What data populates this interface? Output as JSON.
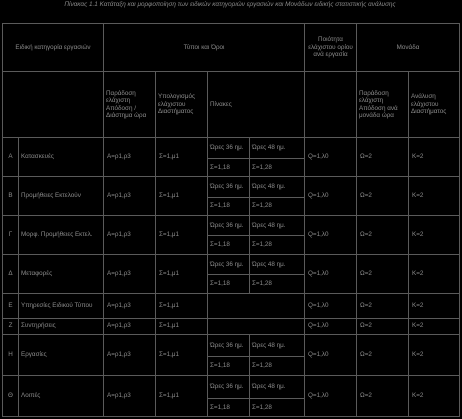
{
  "caption": "Πίνακας 1.1 Κατάταξη και μορφοποίηση των ειδικών κατηγοριών εργασιών και Μονάδων ειδικής στατιστικής ανάλυσης",
  "headers": {
    "cat": "Ειδική κατηγορία εργασιών",
    "pay_group": "Τύποι και Όροι",
    "pay_a": "Παράδοση ελάχιστη Απόδοση / Διάστημα ώρα",
    "pay_b": "Υπολογισμός ελάχιστου Διαστήματος",
    "pay_c": "Πίνακες",
    "qual": "Ποιότητα ελάχιστου ορίου ανά εργασία",
    "unit_group": "Μονάδα",
    "unit_a": "Παράδοση ελάχιστη Απόδοση ανά μονάδα ώρα",
    "unit_b": "Ανάλυση ελάχιστου Διαστήματος"
  },
  "rows": [
    {
      "id": "A",
      "name": "Κατασκευές",
      "pa": "Α=ρ1,ρ3",
      "pb": "Σ=1,μ1",
      "c1": [
        "Ώρες 36 ημ.",
        "Σ=1,18"
      ],
      "c2": [
        "Ώρες 48 ημ.",
        "Σ=1,28"
      ],
      "q": "Q=1,λ0",
      "ua": "Ω=2",
      "ub": "Κ=2"
    },
    {
      "id": "Β",
      "name": "Προμήθειες Εκτελούν",
      "pa": "Α=ρ1,ρ3",
      "pb": "Σ=1,μ1",
      "c1": [
        "Ώρες 36 ημ.",
        "Σ=1,18"
      ],
      "c2": [
        "Ώρες 48 ημ.",
        "Σ=1,28"
      ],
      "q": "Q=1,λ0",
      "ua": "Ω=2",
      "ub": "Κ=2"
    },
    {
      "id": "Γ",
      "name": "Μορφ. Προμήθειες Εκτελ.",
      "pa": "Α=ρ1,ρ3",
      "pb": "Σ=1,μ1",
      "c1": [
        "Ώρες 36 ημ.",
        "Σ=1,18"
      ],
      "c2": [
        "Ώρες 48 ημ.",
        "Σ=1,28"
      ],
      "q": "Q=1,λ0",
      "ua": "Ω=2",
      "ub": "Κ=2"
    },
    {
      "id": "Δ",
      "name": "Μεταφορές",
      "pa": "Α=ρ1,ρ3",
      "pb": "Σ=1,μ1",
      "c1": [
        "Ώρες 36 ημ.",
        "Σ=1,18"
      ],
      "c2": [
        "Ώρες 48 ημ.",
        "Σ=1,28"
      ],
      "q": "Q=1,λ0",
      "ua": "Ω=2",
      "ub": "Κ=2"
    },
    {
      "id": "Ε",
      "name": "Υπηρεσίες Ειδικού Τύπου",
      "pa": "Α=ρ1,ρ3",
      "pb": "Σ=1,μ1",
      "c1": [
        "",
        ""
      ],
      "c2": [
        "",
        ""
      ],
      "q": "Q=1,λ0",
      "ua": "Ω=2",
      "ub": "Κ=2"
    },
    {
      "id": "Ζ",
      "name": "Συντηρήσεις",
      "pa": "Α=ρ1,ρ3",
      "pb": "Σ=1,μ1",
      "c1": [
        "",
        ""
      ],
      "c2": [
        "",
        ""
      ],
      "q": "Q=1,λ0",
      "ua": "Ω=2",
      "ub": "Κ=2"
    },
    {
      "id": "Η",
      "name": "Εργασίες",
      "pa": "Α=ρ1,ρ3",
      "pb": "Σ=1,μ1",
      "c1": [
        "Ώρες 36 ημ.",
        "Σ=1,18"
      ],
      "c2": [
        "Ώρες 48 ημ.",
        "Σ=1,28"
      ],
      "q": "Q=1,λ0",
      "ua": "Ω=2",
      "ub": "Κ=2"
    },
    {
      "id": "Θ",
      "name": "Λοιπές",
      "pa": "Α=ρ1,ρ3",
      "pb": "Σ=1,μ1",
      "c1": [
        "Ώρες 36 ημ.",
        "Σ=1,18"
      ],
      "c2": [
        "Ώρες 48 ημ.",
        "Σ=1,28"
      ],
      "q": "Q=1,λ0",
      "ua": "Ω=2",
      "ub": "Κ=2"
    }
  ]
}
